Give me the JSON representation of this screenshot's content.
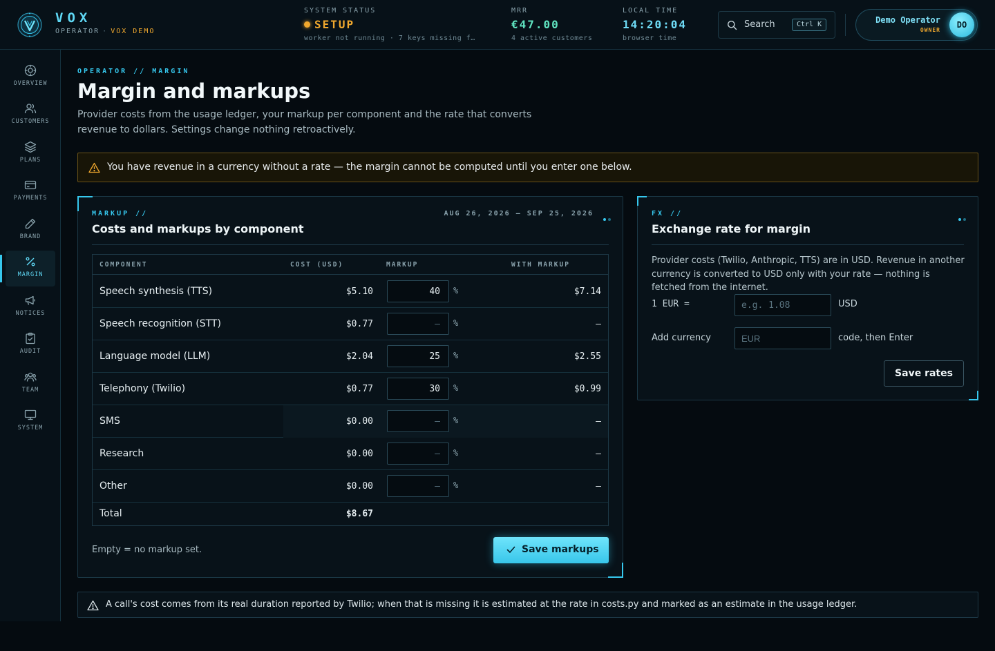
{
  "app": {
    "name": "VOX",
    "subtitle": "OPERATOR",
    "subtitle_sep": "·",
    "env": "VOX DEMO"
  },
  "header": {
    "system_status": {
      "label": "SYSTEM STATUS",
      "value": "SETUP",
      "detail": "worker not running · 7 keys missing f…",
      "color": "#f0a82e"
    },
    "mrr": {
      "label": "MRR",
      "value": "€47.00",
      "detail": "4 active customers",
      "color": "#5fe3c0"
    },
    "local_time": {
      "label": "LOCAL TIME",
      "value": "14:20:04",
      "detail": "browser time",
      "color": "#6fdcf7"
    },
    "search": {
      "label": "Search",
      "shortcut": "Ctrl K"
    },
    "user": {
      "name": "Demo Operator",
      "role": "OWNER",
      "initials": "DO"
    }
  },
  "sidebar": {
    "items": [
      {
        "label": "OVERVIEW",
        "icon": "overview-icon"
      },
      {
        "label": "CUSTOMERS",
        "icon": "customers-icon"
      },
      {
        "label": "PLANS",
        "icon": "layers-icon"
      },
      {
        "label": "PAYMENTS",
        "icon": "card-icon"
      },
      {
        "label": "BRAND",
        "icon": "pen-icon"
      },
      {
        "label": "MARGIN",
        "icon": "percent-icon",
        "active": true
      },
      {
        "label": "NOTICES",
        "icon": "megaphone-icon"
      },
      {
        "label": "AUDIT",
        "icon": "clipboard-icon"
      },
      {
        "label": "TEAM",
        "icon": "team-icon"
      },
      {
        "label": "SYSTEM",
        "icon": "monitor-icon"
      }
    ]
  },
  "page": {
    "breadcrumb": "OPERATOR // MARGIN",
    "title": "Margin and markups",
    "description": "Provider costs from the usage ledger, your markup per component and the rate that converts revenue to dollars. Settings change nothing retroactively."
  },
  "alert": {
    "text": "You have revenue in a currency without a rate — the margin cannot be computed until you enter one below."
  },
  "markup_panel": {
    "eyebrow": "MARKUP //",
    "title": "Costs and markups by component",
    "range": "AUG 26, 2026 – SEP 25, 2026",
    "columns": [
      "COMPONENT",
      "COST (USD)",
      "MARKUP",
      "WITH MARKUP"
    ],
    "rows": [
      {
        "component": "Speech synthesis (TTS)",
        "cost": "$5.10",
        "markup": "40",
        "with_markup": "$7.14"
      },
      {
        "component": "Speech recognition (STT)",
        "cost": "$0.77",
        "markup": "",
        "with_markup": "–"
      },
      {
        "component": "Language model (LLM)",
        "cost": "$2.04",
        "markup": "25",
        "with_markup": "$2.55"
      },
      {
        "component": "Telephony (Twilio)",
        "cost": "$0.77",
        "markup": "30",
        "with_markup": "$0.99"
      },
      {
        "component": "SMS",
        "cost": "$0.00",
        "markup": "",
        "with_markup": "–"
      },
      {
        "component": "Research",
        "cost": "$0.00",
        "markup": "",
        "with_markup": "–"
      },
      {
        "component": "Other",
        "cost": "$0.00",
        "markup": "",
        "with_markup": "–"
      }
    ],
    "markup_placeholder": "–",
    "pct_sign": "%",
    "total_label": "Total",
    "total_cost": "$8.67",
    "footnote": "Empty = no markup set.",
    "save_label": "Save markups"
  },
  "fx_panel": {
    "eyebrow": "FX //",
    "title": "Exchange rate for margin",
    "description": "Provider costs (Twilio, Anthropic, TTS) are in USD. Revenue in another currency is converted to USD only with your rate — nothing is fetched from the internet.",
    "rate_label": "1 EUR =",
    "rate_placeholder": "e.g. 1.08",
    "rate_unit": "USD",
    "add_label": "Add currency",
    "add_placeholder": "EUR",
    "add_hint": "code, then Enter",
    "save_label": "Save rates"
  },
  "info": {
    "text": "A call's cost comes from its real duration reported by Twilio; when that is missing it is estimated at the rate in costs.py and marked as an estimate in the usage ledger."
  },
  "colors": {
    "accent": "#36c8ee",
    "warning": "#f0a82e",
    "background": "#050b10"
  }
}
